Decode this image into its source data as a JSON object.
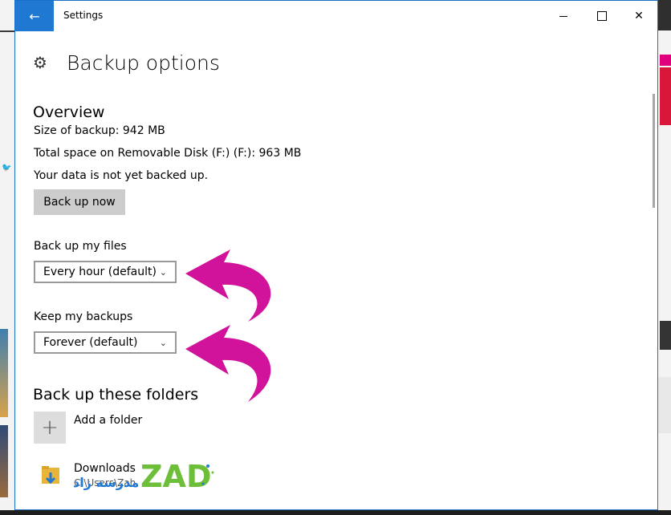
{
  "window": {
    "title": "Settings",
    "back_icon": "back-arrow-icon",
    "controls": [
      "minimize-icon",
      "maximize-icon",
      "close-icon"
    ]
  },
  "page": {
    "title": "Backup options",
    "icon": "gear-icon"
  },
  "overview": {
    "heading": "Overview",
    "size_of_backup": "Size of backup: 942 MB",
    "total_space": "Total space on Removable Disk (F:) (F:): 963 MB",
    "status": "Your data is not yet backed up.",
    "back_up_now_label": "Back up now"
  },
  "backup_files": {
    "label": "Back up my files",
    "selected": "Every hour (default)"
  },
  "keep_backups": {
    "label": "Keep my backups",
    "selected": "Forever (default)"
  },
  "folders": {
    "heading": "Back up these folders",
    "add_label": "Add a folder",
    "items": [
      {
        "name": "Downloads",
        "path": "C:\\Users\\Zah"
      }
    ]
  },
  "watermark": {
    "text_latin": "ZAD",
    "text_arabic": "مدرسة زاد"
  },
  "colors": {
    "accent": "#1f78d1",
    "annotation_arrow": "#d1129a",
    "button_bg": "#cccccc"
  }
}
